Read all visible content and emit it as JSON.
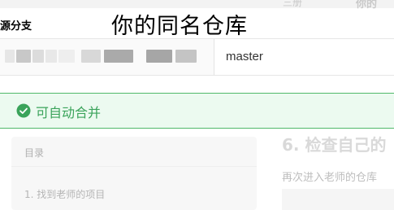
{
  "header": {
    "faded_tab_1": "三册",
    "faded_tab_2": "你的",
    "source_branch_label": "源分支",
    "overlay_title": "你的同名仓库"
  },
  "branch_selector": {
    "branch_value": "master"
  },
  "merge_status": {
    "icon": "check-circle-icon",
    "text": "可自动合并",
    "color": "#3aa35a"
  },
  "sidebar_toc": {
    "title": "目录",
    "items": [
      "1. 找到老师的项目"
    ]
  },
  "article": {
    "heading": "6. 检查自己的",
    "paragraph": "再次进入老师的仓库"
  }
}
